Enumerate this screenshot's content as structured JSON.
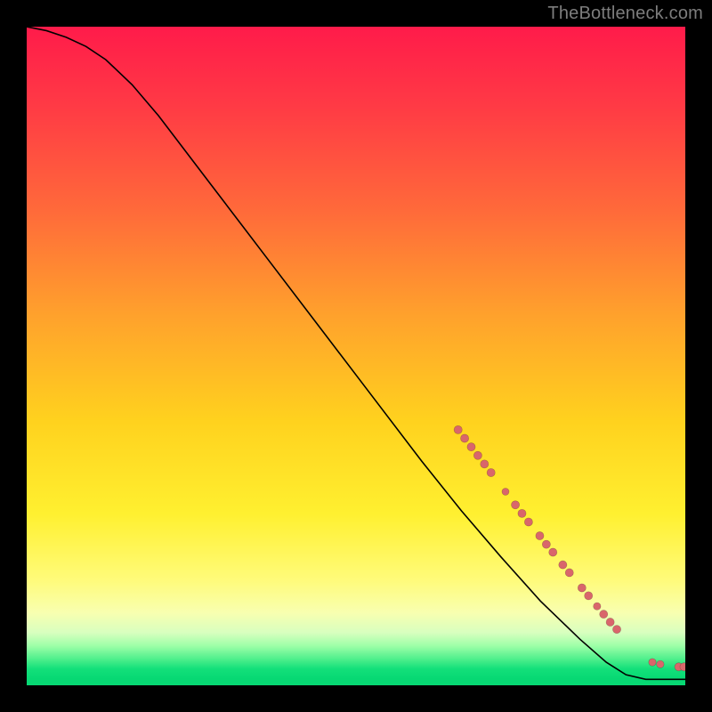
{
  "watermark": "TheBottleneck.com",
  "chart_data": {
    "type": "line",
    "title": "",
    "xlabel": "",
    "ylabel": "",
    "xlim": [
      0,
      100
    ],
    "ylim": [
      0,
      100
    ],
    "grid": false,
    "legend": false,
    "curve": [
      {
        "x": 0,
        "y": 100.0
      },
      {
        "x": 3,
        "y": 99.4
      },
      {
        "x": 6,
        "y": 98.4
      },
      {
        "x": 9,
        "y": 97.0
      },
      {
        "x": 12,
        "y": 95.0
      },
      {
        "x": 16,
        "y": 91.2
      },
      {
        "x": 20,
        "y": 86.5
      },
      {
        "x": 28,
        "y": 76.0
      },
      {
        "x": 36,
        "y": 65.5
      },
      {
        "x": 44,
        "y": 55.0
      },
      {
        "x": 52,
        "y": 44.5
      },
      {
        "x": 60,
        "y": 34.0
      },
      {
        "x": 66,
        "y": 26.5
      },
      {
        "x": 72,
        "y": 19.5
      },
      {
        "x": 78,
        "y": 12.8
      },
      {
        "x": 84,
        "y": 7.0
      },
      {
        "x": 88,
        "y": 3.5
      },
      {
        "x": 91,
        "y": 1.6
      },
      {
        "x": 94,
        "y": 0.9
      },
      {
        "x": 97,
        "y": 0.9
      },
      {
        "x": 100,
        "y": 0.9
      }
    ],
    "markers": [
      {
        "x": 65.5,
        "y": 38.8,
        "r": 4.6
      },
      {
        "x": 66.5,
        "y": 37.5,
        "r": 4.6
      },
      {
        "x": 67.5,
        "y": 36.2,
        "r": 4.6
      },
      {
        "x": 68.5,
        "y": 34.9,
        "r": 4.6
      },
      {
        "x": 69.5,
        "y": 33.6,
        "r": 4.6
      },
      {
        "x": 70.5,
        "y": 32.3,
        "r": 4.6
      },
      {
        "x": 72.7,
        "y": 29.4,
        "r": 4.0
      },
      {
        "x": 74.2,
        "y": 27.4,
        "r": 4.6
      },
      {
        "x": 75.2,
        "y": 26.1,
        "r": 4.6
      },
      {
        "x": 76.2,
        "y": 24.8,
        "r": 4.6
      },
      {
        "x": 77.9,
        "y": 22.7,
        "r": 4.6
      },
      {
        "x": 78.9,
        "y": 21.4,
        "r": 4.6
      },
      {
        "x": 79.9,
        "y": 20.2,
        "r": 4.6
      },
      {
        "x": 81.4,
        "y": 18.3,
        "r": 4.6
      },
      {
        "x": 82.4,
        "y": 17.1,
        "r": 4.6
      },
      {
        "x": 84.3,
        "y": 14.8,
        "r": 4.6
      },
      {
        "x": 85.3,
        "y": 13.6,
        "r": 4.6
      },
      {
        "x": 86.6,
        "y": 12.0,
        "r": 4.2
      },
      {
        "x": 87.6,
        "y": 10.8,
        "r": 4.6
      },
      {
        "x": 88.6,
        "y": 9.6,
        "r": 4.6
      },
      {
        "x": 89.6,
        "y": 8.5,
        "r": 4.6
      },
      {
        "x": 95.0,
        "y": 3.5,
        "r": 4.2
      },
      {
        "x": 96.2,
        "y": 3.2,
        "r": 4.2
      },
      {
        "x": 99.0,
        "y": 2.8,
        "r": 4.6
      },
      {
        "x": 99.8,
        "y": 2.8,
        "r": 4.6
      }
    ],
    "background_gradient": {
      "top": "#ff1b4a",
      "mid1": "#ffa22c",
      "mid2": "#fff030",
      "bottom": "#07d873"
    }
  }
}
